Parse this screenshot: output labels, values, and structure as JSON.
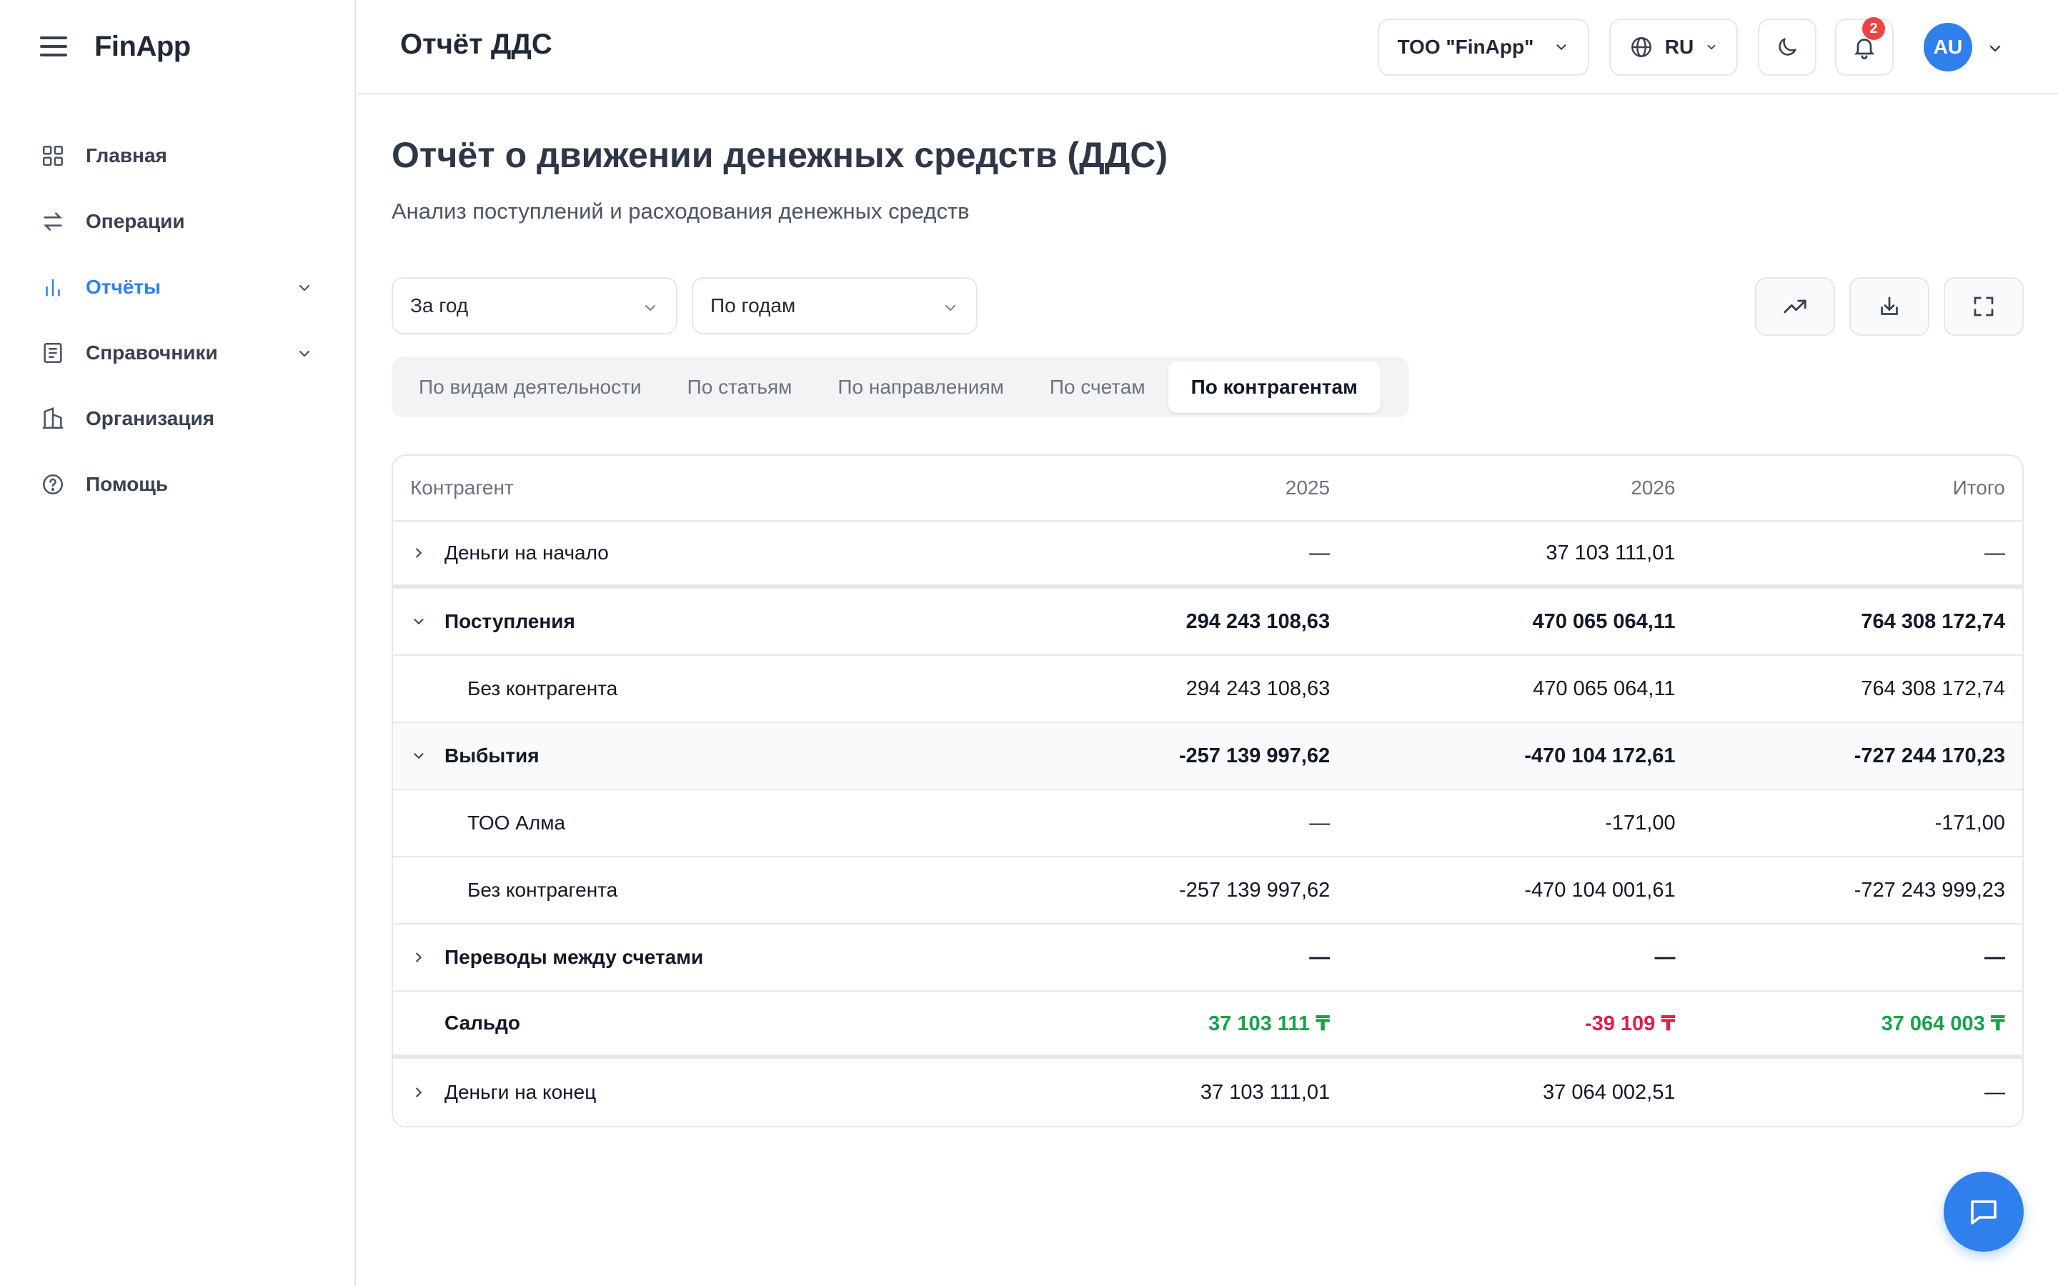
{
  "app": {
    "name": "FinApp"
  },
  "sidebar": {
    "items": [
      {
        "label": "Главная",
        "icon": "grid-icon"
      },
      {
        "label": "Операции",
        "icon": "arrows-swap-icon"
      },
      {
        "label": "Отчёты",
        "icon": "bar-chart-icon",
        "active": true
      },
      {
        "label": "Справочники",
        "icon": "book-icon"
      },
      {
        "label": "Организация",
        "icon": "building-icon"
      },
      {
        "label": "Помощь",
        "icon": "help-circle-icon"
      }
    ]
  },
  "header": {
    "title": "Отчёт ДДС",
    "org": "ТОО \"FinApp\"",
    "lang": "RU",
    "notifications_count": "2",
    "avatar_initials": "AU"
  },
  "page": {
    "title": "Отчёт о движении денежных средств (ДДС)",
    "subtitle": "Анализ поступлений и расходования денежных средств"
  },
  "filters": {
    "period": "За год",
    "grouping": "По годам"
  },
  "tabs": [
    {
      "label": "По видам деятельности"
    },
    {
      "label": "По статьям"
    },
    {
      "label": "По направлениям"
    },
    {
      "label": "По счетам"
    },
    {
      "label": "По контрагентам",
      "active": true
    }
  ],
  "table": {
    "headers": {
      "name": "Контрагент",
      "y1": "2025",
      "y2": "2026",
      "total": "Итого"
    },
    "rows": [
      {
        "name": "Деньги на начало",
        "y1": "—",
        "y2": "37 103 111,01",
        "total": "—"
      },
      {
        "name": "Поступления",
        "y1": "294 243 108,63",
        "y2": "470 065 064,11",
        "total": "764 308 172,74"
      },
      {
        "name": "Без контрагента",
        "y1": "294 243 108,63",
        "y2": "470 065 064,11",
        "total": "764 308 172,74"
      },
      {
        "name": "Выбытия",
        "y1": "-257 139 997,62",
        "y2": "-470 104 172,61",
        "total": "-727 244 170,23"
      },
      {
        "name": "ТОО Алма",
        "y1": "—",
        "y2": "-171,00",
        "total": "-171,00"
      },
      {
        "name": "Без контрагента",
        "y1": "-257 139 997,62",
        "y2": "-470 104 001,61",
        "total": "-727 243 999,23"
      },
      {
        "name": "Переводы между счетами",
        "y1": "—",
        "y2": "—",
        "total": "—"
      },
      {
        "name": "Сальдо",
        "y1": "37 103 111 ₸",
        "y2": "-39 109 ₸",
        "total": "37 064 003 ₸"
      },
      {
        "name": "Деньги на конец",
        "y1": "37 103 111,01",
        "y2": "37 064 002,51",
        "total": "—"
      }
    ]
  },
  "colors": {
    "accent": "#2f80ed",
    "positive": "#16a34a",
    "negative": "#e11d48",
    "badge": "#ef4444"
  }
}
